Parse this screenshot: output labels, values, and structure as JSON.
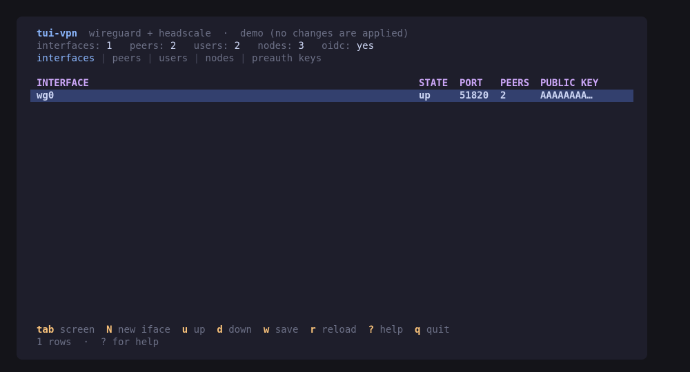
{
  "header": {
    "app_name": "tui-vpn",
    "subtitle": "wireguard + headscale",
    "dot": "·",
    "mode": "demo (no changes are applied)"
  },
  "stats": [
    {
      "label": "interfaces:",
      "value": "1"
    },
    {
      "label": "peers:",
      "value": "2"
    },
    {
      "label": "users:",
      "value": "2"
    },
    {
      "label": "nodes:",
      "value": "3"
    },
    {
      "label": "oidc:",
      "value": "yes"
    }
  ],
  "tabs": [
    {
      "label": "interfaces",
      "active": true
    },
    {
      "label": "peers",
      "active": false
    },
    {
      "label": "users",
      "active": false
    },
    {
      "label": "nodes",
      "active": false
    },
    {
      "label": "preauth keys",
      "active": false
    }
  ],
  "tab_separator": "|",
  "table": {
    "columns": [
      "INTERFACE",
      "STATE",
      "PORT",
      "PEERS",
      "PUBLIC KEY"
    ],
    "rows": [
      {
        "interface": "wg0",
        "state": "up",
        "port": "51820",
        "peers": "2",
        "public_key": "AAAAAAAA…",
        "selected": true
      }
    ]
  },
  "keybindings": [
    {
      "key": "tab",
      "action": "screen"
    },
    {
      "key": "N",
      "action": "new iface"
    },
    {
      "key": "u",
      "action": "up"
    },
    {
      "key": "d",
      "action": "down"
    },
    {
      "key": "w",
      "action": "save"
    },
    {
      "key": "r",
      "action": "reload"
    },
    {
      "key": "?",
      "action": "help"
    },
    {
      "key": "q",
      "action": "quit"
    }
  ],
  "status": {
    "rows_text": "1 rows",
    "dot": "·",
    "help_text": "? for help"
  },
  "colors": {
    "background": "#141419",
    "window": "#1e1e2b",
    "accent": "#89b4fa",
    "header": "#cba6f7",
    "selection": "#33406e",
    "key": "#f9c27a"
  }
}
